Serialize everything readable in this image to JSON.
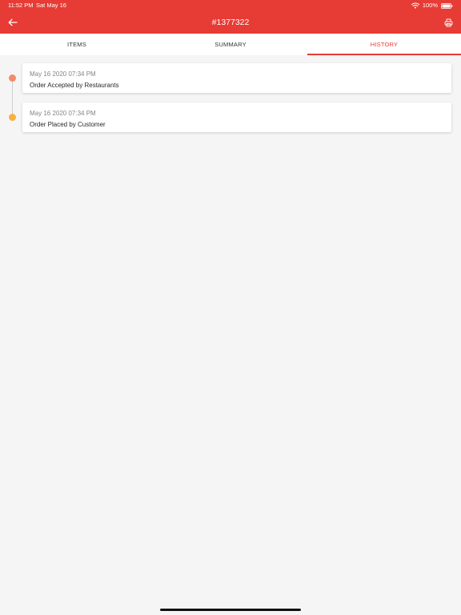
{
  "status_bar": {
    "time": "11:52 PM",
    "date": "Sat May 16",
    "battery": "100%"
  },
  "header": {
    "title": "#1377322",
    "back_icon": "arrow-left-icon",
    "print_icon": "printer-icon",
    "background_color": "#e63c35"
  },
  "tabs": [
    {
      "label": "ITEMS",
      "active": false
    },
    {
      "label": "SUMMARY",
      "active": false
    },
    {
      "label": "HISTORY",
      "active": true
    }
  ],
  "history": [
    {
      "date": "May 16 2020 07:34 PM",
      "event": "Order Accepted by Restaurants",
      "dot_color": "#f28b6a"
    },
    {
      "date": "May 16 2020 07:34 PM",
      "event": "Order Placed by Customer",
      "dot_color": "#f6b23e"
    }
  ],
  "colors": {
    "accent": "#e63c35",
    "background": "#f6f5f5"
  }
}
